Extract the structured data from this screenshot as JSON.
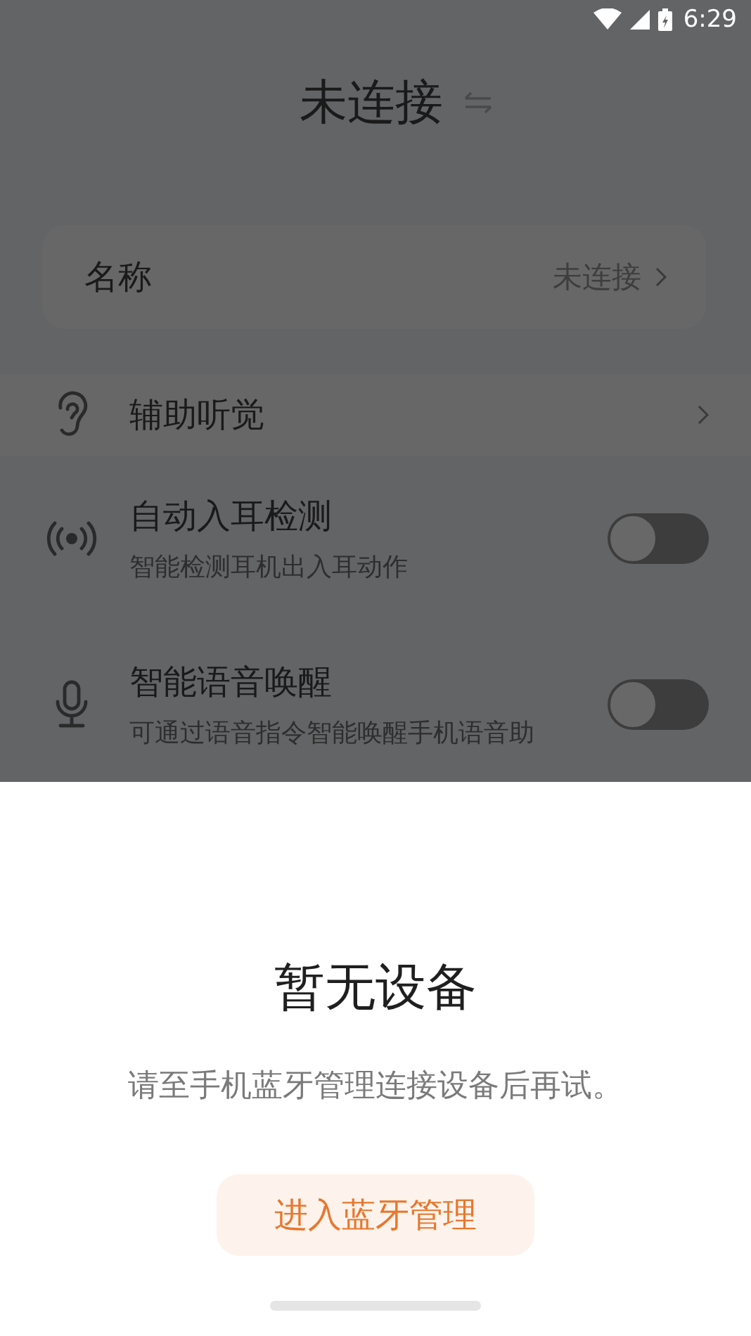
{
  "status_bar": {
    "time": "6:29"
  },
  "title": "未连接",
  "name_row": {
    "label": "名称",
    "value": "未连接"
  },
  "hearing_row": {
    "label": "辅助听觉"
  },
  "settings": [
    {
      "kind": "detect",
      "label": "自动入耳检测",
      "description": "智能检测耳机出入耳动作",
      "on": false
    },
    {
      "kind": "mic",
      "label": "智能语音唤醒",
      "description": "可通过语音指令智能唤醒手机语音助",
      "on": false
    }
  ],
  "sheet": {
    "title": "暂无设备",
    "message": "请至手机蓝牙管理连接设备后再试。",
    "button": "进入蓝牙管理"
  }
}
